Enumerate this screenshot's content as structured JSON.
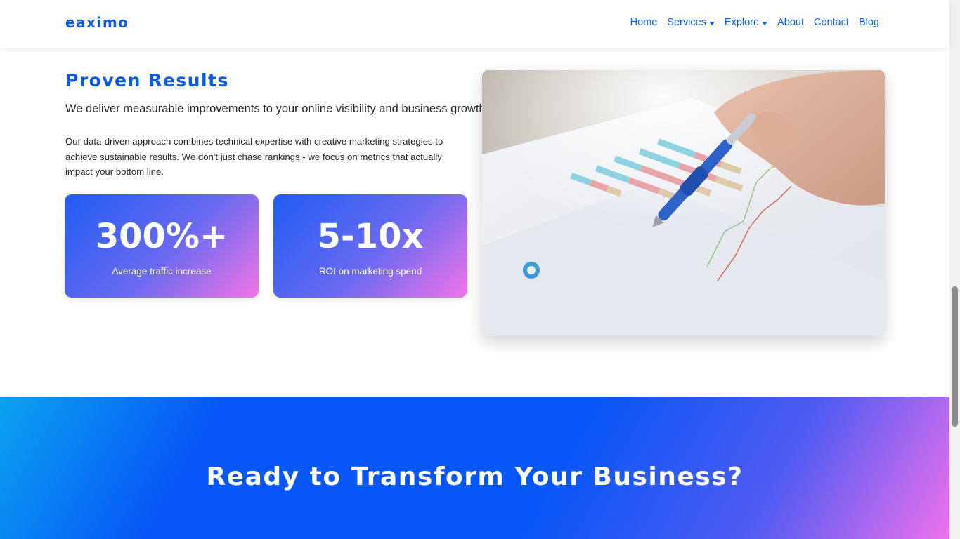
{
  "navbar": {
    "brand": "eaximo",
    "items": [
      {
        "label": "Home",
        "dropdown": false
      },
      {
        "label": "Services",
        "dropdown": true
      },
      {
        "label": "Explore",
        "dropdown": true
      },
      {
        "label": "About",
        "dropdown": false
      },
      {
        "label": "Contact",
        "dropdown": false
      },
      {
        "label": "Blog",
        "dropdown": false
      }
    ]
  },
  "results": {
    "title": "Proven Results",
    "lead": "We deliver measurable improvements to your online visibility and business growth",
    "body": "Our data-driven approach combines technical expertise with creative marketing strategies to achieve sustainable results. We don't just chase rankings - we focus on metrics that actually impact your bottom line.",
    "stats": [
      {
        "value": "300%+",
        "label": "Average traffic increase"
      },
      {
        "value": "5-10x",
        "label": "ROI on marketing spend"
      }
    ],
    "image_icon": "analytics-chart-photo"
  },
  "cta": {
    "title": "Ready to Transform Your Business?"
  },
  "colors": {
    "brand": "#0a5ae6",
    "gradient_start": "#1f5cf3",
    "gradient_end": "#f374e8",
    "cta_blue": "#0756f7"
  }
}
